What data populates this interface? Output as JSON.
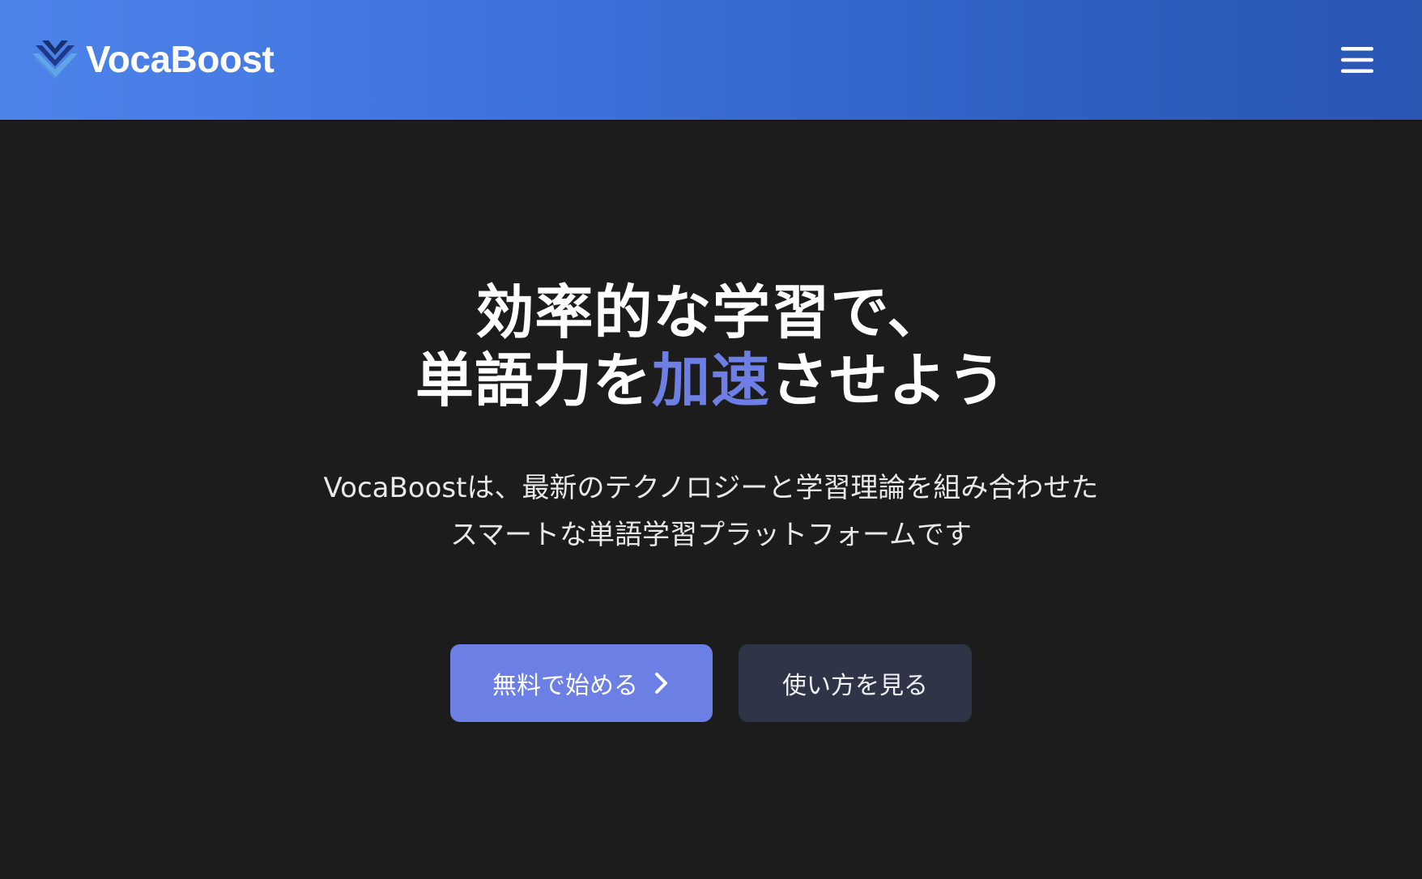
{
  "header": {
    "brand": "VocaBoost",
    "logo_icon": "chevron-stack-logo",
    "menu_icon": "hamburger-menu-icon",
    "colors": {
      "gradient_start": "#4d84ea",
      "gradient_end": "#2a56b4"
    }
  },
  "hero": {
    "headline": {
      "line1": "効率的な学習で、",
      "line2_prefix": "単語力を",
      "line2_accent": "加速",
      "line2_suffix": "させよう"
    },
    "lede": {
      "line1": "VocaBoostは、最新のテクノロジーと学習理論を組み合わせた",
      "line2": "スマートな単語学習プラットフォームです"
    },
    "cta": {
      "primary_label": "無料で始める",
      "primary_icon": "chevron-right-icon",
      "secondary_label": "使い方を見る"
    },
    "colors": {
      "background": "#1c1c1c",
      "accent": "#6d7fe4",
      "primary_button": "#6c7fe4",
      "secondary_button": "#2f3546"
    }
  }
}
